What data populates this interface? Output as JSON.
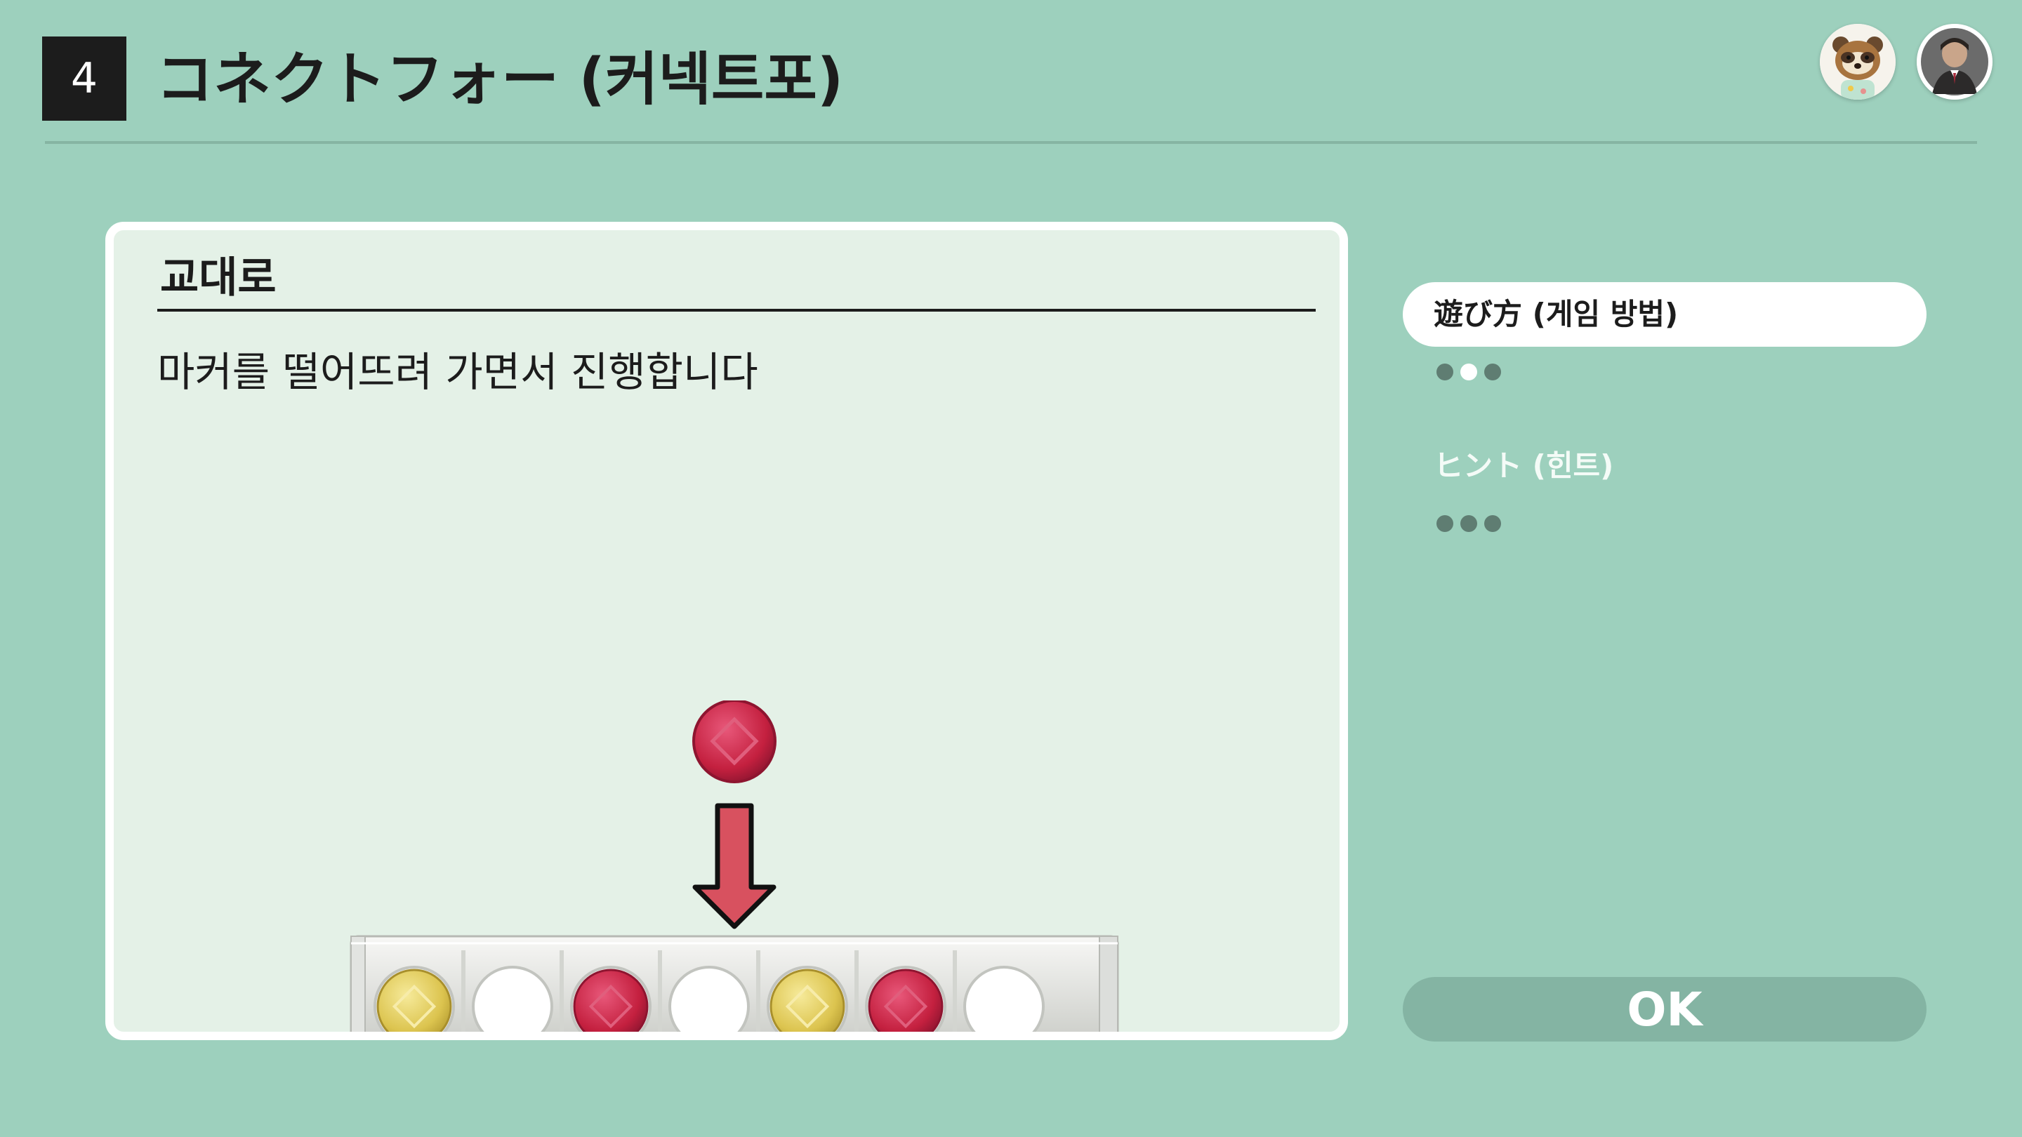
{
  "header": {
    "game_number": "4",
    "title": "コネクトフォー (커넥트포)",
    "avatars": [
      "tanuki-avatar",
      "player-avatar"
    ]
  },
  "panel": {
    "heading": "교대로",
    "text": "마커를 떨어뜨려 가면서 진행합니다",
    "illustration": {
      "falling_marker": "red",
      "slots": [
        "yellow",
        "empty",
        "red",
        "empty",
        "yellow",
        "red",
        "empty"
      ]
    }
  },
  "menu": {
    "items": [
      {
        "label": "遊び方 (게임 방법)",
        "active": true,
        "dots": 3,
        "current_dot": 2
      },
      {
        "label": "ヒント (힌트)",
        "active": false,
        "dots": 3,
        "current_dot": 0
      }
    ]
  },
  "ok_button": {
    "label": "OK"
  },
  "colors": {
    "background": "#9dd0bd",
    "panel": "#e4f1e7",
    "marker_red": "#c8294a",
    "marker_yellow": "#e2cf5a",
    "arrow": "#d8515f"
  }
}
